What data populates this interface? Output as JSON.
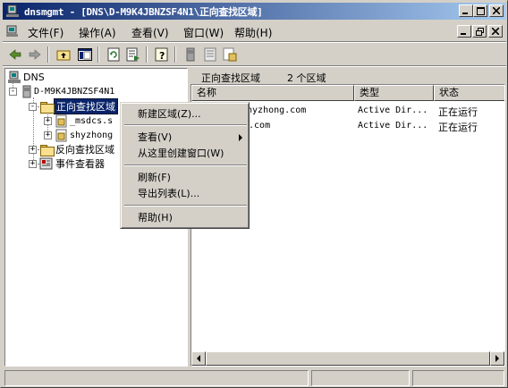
{
  "window": {
    "title": "dnsmgmt - [DNS\\D-M9K4JBNZSF4N1\\正向查找区域]"
  },
  "menu": {
    "items": [
      "文件(F)",
      "操作(A)",
      "查看(V)",
      "窗口(W)",
      "帮助(H)"
    ]
  },
  "tree": {
    "root": "DNS",
    "server": "D-M9K4JBNZSF4N1",
    "forward_zones": "正向查找区域",
    "zone_msdcs": "_msdcs.s",
    "zone_shyzhong": "shyzhong",
    "reverse_zones": "反向查找区域",
    "event_viewer": "事件查看器"
  },
  "right_pane": {
    "header_title": "正向查找区域",
    "header_count": "2 个区域",
    "columns": [
      "名称",
      "类型",
      "状态"
    ],
    "rows": [
      {
        "name": "_msdcs.shyzhong.com",
        "name_visible": "shyzhong.com",
        "type": "Active Dir...",
        "status": "正在运行"
      },
      {
        "name": "shyzhong.com",
        "name_visible": "g.com",
        "type": "Active Dir...",
        "status": "正在运行"
      }
    ]
  },
  "context_menu": {
    "new_zone": "新建区域(Z)...",
    "view": "查看(V)",
    "new_window": "从这里创建窗口(W)",
    "refresh": "刷新(F)",
    "export": "导出列表(L)...",
    "help": "帮助(H)"
  },
  "colors": {
    "titlebar_start": "#0a246a",
    "titlebar_end": "#a6caf0",
    "face": "#d4d0c8",
    "selection": "#0a246a"
  }
}
